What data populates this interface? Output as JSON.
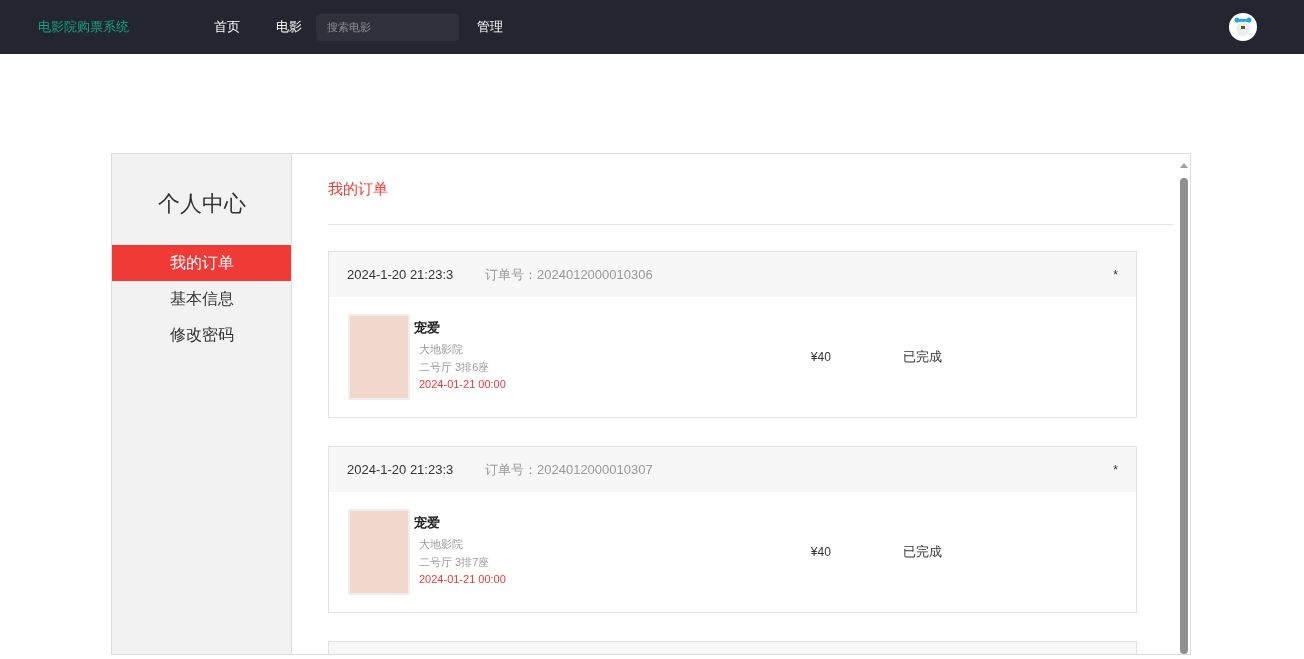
{
  "navbar": {
    "brand": "电影院购票系统",
    "links": [
      {
        "label": "首页"
      },
      {
        "label": "电影"
      }
    ],
    "search": {
      "placeholder": "搜索电影"
    },
    "admin_link": "管理"
  },
  "sidebar": {
    "title": "个人中心",
    "items": [
      {
        "label": "我的订单",
        "selected": true
      },
      {
        "label": "基本信息",
        "selected": false
      },
      {
        "label": "修改密码",
        "selected": false
      }
    ]
  },
  "content": {
    "title": "我的订单",
    "orders": [
      {
        "time": "2024-1-20 21:23:3",
        "order_no": "订单号：2024012000010306",
        "mark": "*",
        "movie": "宠爱",
        "cinema": "大地影院",
        "seat": "二号厅 3排6座",
        "showtime": "2024-01-21 00:00",
        "price": "¥40",
        "status": "已完成"
      },
      {
        "time": "2024-1-20 21:23:3",
        "order_no": "订单号：2024012000010307",
        "mark": "*",
        "movie": "宠爱",
        "cinema": "大地影院",
        "seat": "二号厅 3排7座",
        "showtime": "2024-01-21 00:00",
        "price": "¥40",
        "status": "已完成"
      }
    ]
  }
}
